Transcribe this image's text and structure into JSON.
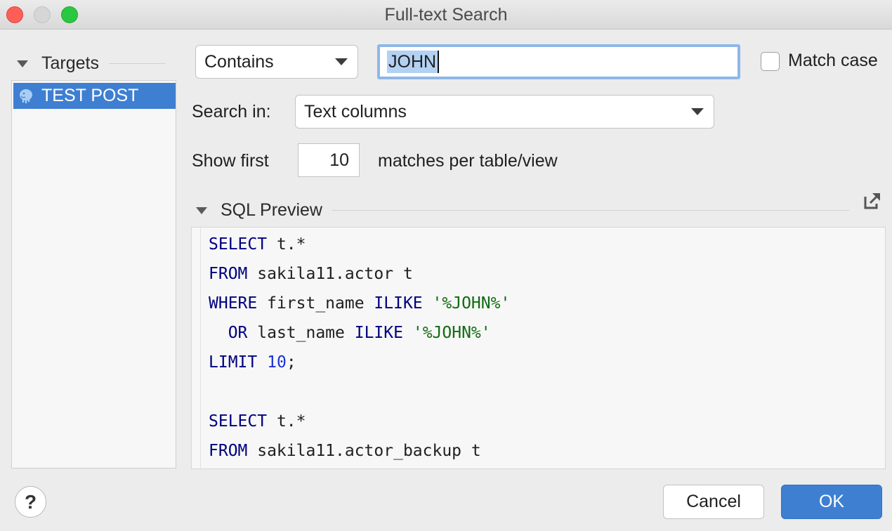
{
  "window": {
    "title": "Full-text Search"
  },
  "targets": {
    "header": "Targets",
    "items": [
      {
        "label": "TEST POST",
        "icon": "postgresql-elephant-icon"
      }
    ]
  },
  "match_mode": {
    "value": "Contains"
  },
  "search": {
    "value": "JOHN"
  },
  "match_case": {
    "label": "Match case",
    "checked": false
  },
  "search_in": {
    "label": "Search in:",
    "value": "Text columns"
  },
  "show_first": {
    "label": "Show first",
    "value": "10",
    "suffix": "matches per table/view"
  },
  "sql_preview": {
    "header": "SQL Preview",
    "lines": [
      [
        {
          "t": "SELECT",
          "c": "kw"
        },
        {
          "t": " t.*",
          "c": ""
        }
      ],
      [
        {
          "t": "FROM",
          "c": "kw"
        },
        {
          "t": " sakila11.actor t",
          "c": ""
        }
      ],
      [
        {
          "t": "WHERE",
          "c": "kw"
        },
        {
          "t": " first_name ",
          "c": ""
        },
        {
          "t": "ILIKE",
          "c": "kw"
        },
        {
          "t": " ",
          "c": ""
        },
        {
          "t": "'%JOHN%'",
          "c": "str"
        }
      ],
      [
        {
          "t": "  ",
          "c": ""
        },
        {
          "t": "OR",
          "c": "kw"
        },
        {
          "t": " last_name ",
          "c": ""
        },
        {
          "t": "ILIKE",
          "c": "kw"
        },
        {
          "t": " ",
          "c": ""
        },
        {
          "t": "'%JOHN%'",
          "c": "str"
        }
      ],
      [
        {
          "t": "LIMIT",
          "c": "kw"
        },
        {
          "t": " ",
          "c": ""
        },
        {
          "t": "10",
          "c": "num"
        },
        {
          "t": ";",
          "c": ""
        }
      ],
      [],
      [
        {
          "t": "SELECT",
          "c": "kw"
        },
        {
          "t": " t.*",
          "c": ""
        }
      ],
      [
        {
          "t": "FROM",
          "c": "kw"
        },
        {
          "t": " sakila11.actor_backup t",
          "c": ""
        }
      ]
    ]
  },
  "buttons": {
    "help": "?",
    "cancel": "Cancel",
    "ok": "OK"
  },
  "colors": {
    "accent": "#3f7fd2",
    "keyword": "#000080",
    "string": "#106b10",
    "number": "#1c33d4"
  }
}
